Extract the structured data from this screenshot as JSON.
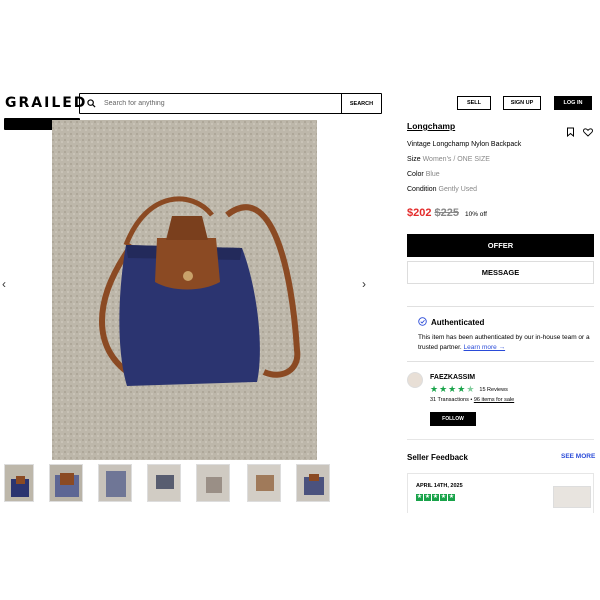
{
  "header": {
    "logo": "GRAILED",
    "search_placeholder": "Search for anything",
    "search_button": "SEARCH",
    "sell": "SELL",
    "sign_up": "SIGN UP",
    "log_in": "LOG IN"
  },
  "product": {
    "brand": "Longchamp",
    "title": "Vintage Longchamp Nylon Backpack",
    "size_label": "Size",
    "size_value": "Women's / ONE SIZE",
    "color_label": "Color",
    "color_value": "Blue",
    "condition_label": "Condition",
    "condition_value": "Gently Used",
    "price": "$202",
    "original_price": "$225",
    "discount": "10% off",
    "offer_button": "OFFER",
    "message_button": "MESSAGE"
  },
  "authenticated": {
    "title": "Authenticated",
    "text": "This item has been authenticated by our in-house team or a trusted partner.",
    "link": "Learn more →"
  },
  "seller": {
    "name": "FAEZKASSIM",
    "rating": 4.5,
    "reviews": "15 Reviews",
    "transactions": "31 Transactions",
    "bullet": "•",
    "items_for_sale": "96 items for sale",
    "follow_button": "FOLLOW"
  },
  "feedback": {
    "title": "Seller Feedback",
    "see_more": "SEE MORE",
    "date": "APRIL 14TH, 2025",
    "stars": 5
  },
  "colors": {
    "accent_blue": "#2a4bd8",
    "price_red": "#e32b2b",
    "star_green": "#19a34a",
    "bag_navy": "#2b3470",
    "strap_brown": "#8b4a23",
    "carpet": "#bdb7aa"
  },
  "icons": {
    "search": "search-icon",
    "share": "share-icon",
    "heart": "heart-icon",
    "verified": "check-badge-icon",
    "prev": "chevron-left-icon",
    "next": "chevron-right-icon"
  }
}
